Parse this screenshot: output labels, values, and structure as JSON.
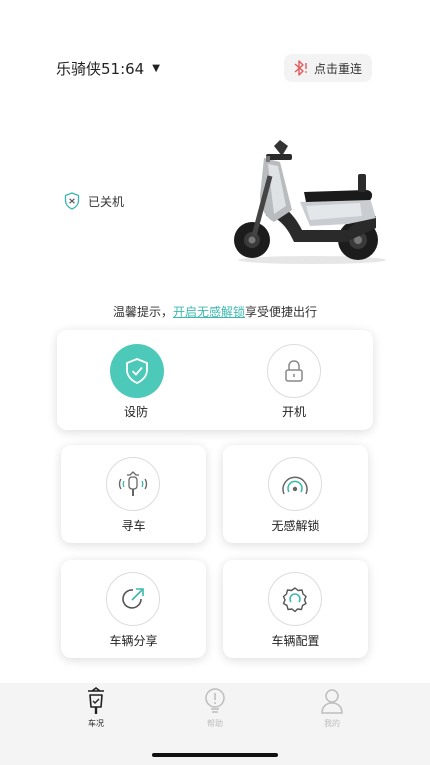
{
  "header": {
    "vehicle_name": "乐骑侠51:64",
    "reconnect_label": "点击重连",
    "bluetooth_icon": "bluetooth-disconnected-icon"
  },
  "status": {
    "text": "已关机",
    "icon": "shield-x-icon"
  },
  "tip": {
    "prefix": "温馨提示，",
    "link": "开启无感解锁",
    "suffix": "享受便捷出行"
  },
  "controls": {
    "arm_label": "设防",
    "power_label": "开机",
    "find_label": "寻车",
    "keyless_label": "无感解锁",
    "share_label": "车辆分享",
    "config_label": "车辆配置"
  },
  "nav": {
    "items": [
      {
        "label": "车况",
        "icon": "scooter-status-icon",
        "active": true
      },
      {
        "label": "帮助",
        "icon": "lightbulb-icon",
        "active": false
      },
      {
        "label": "我的",
        "icon": "user-icon",
        "active": false
      }
    ]
  },
  "colors": {
    "accent": "#4cc9b9",
    "link": "#3bb8ad",
    "nav_active": "#222222",
    "nav_inactive": "#bdbdbd",
    "bluetooth_red": "#e05a5a"
  }
}
